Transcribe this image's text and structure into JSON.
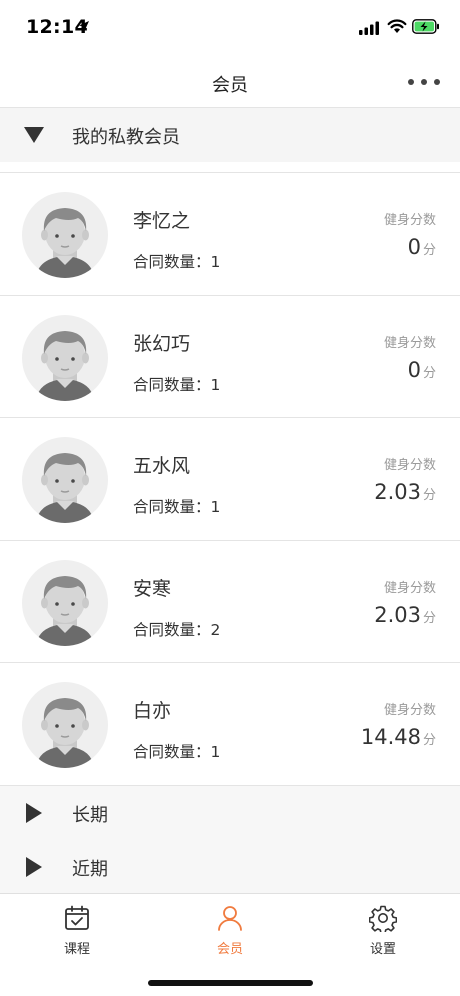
{
  "status_bar": {
    "time": "12:14"
  },
  "nav": {
    "title": "会员"
  },
  "groups": {
    "private": "我的私教会员",
    "long_term": "长期",
    "recent": "近期"
  },
  "members": [
    {
      "name": "李忆之",
      "contract_label": "合同数量：",
      "contract_count": "1",
      "score_label": "健身分数",
      "score": "0",
      "score_unit": "分"
    },
    {
      "name": "张幻巧",
      "contract_label": "合同数量：",
      "contract_count": "1",
      "score_label": "健身分数",
      "score": "0",
      "score_unit": "分"
    },
    {
      "name": "五水风",
      "contract_label": "合同数量：",
      "contract_count": "1",
      "score_label": "健身分数",
      "score": "2.03",
      "score_unit": "分"
    },
    {
      "name": "安寒",
      "contract_label": "合同数量：",
      "contract_count": "2",
      "score_label": "健身分数",
      "score": "2.03",
      "score_unit": "分"
    },
    {
      "name": "白亦",
      "contract_label": "合同数量：",
      "contract_count": "1",
      "score_label": "健身分数",
      "score": "14.48",
      "score_unit": "分"
    }
  ],
  "tabs": [
    {
      "label": "课程",
      "icon": "calendar-check-icon",
      "active": false
    },
    {
      "label": "会员",
      "icon": "person-icon",
      "active": true
    },
    {
      "label": "设置",
      "icon": "gear-icon",
      "active": false
    }
  ],
  "colors": {
    "accent": "#f07b3f",
    "tab_inactive": "#333333",
    "score_label": "#9a9a9a"
  }
}
